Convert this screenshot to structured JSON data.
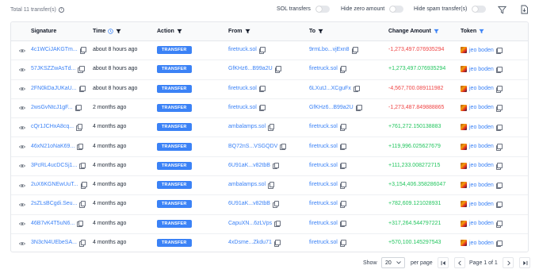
{
  "header": {
    "total_label": "Total 11 transfer(s)",
    "toggles": [
      {
        "label": "SOL transfers",
        "on": false
      },
      {
        "label": "Hide zero amount",
        "on": false
      },
      {
        "label": "Hide spam transfer(s)",
        "on": false
      }
    ],
    "icons": {
      "filter": "filter-icon",
      "export": "export-icon"
    }
  },
  "table": {
    "columns": [
      "Signature",
      "Time",
      "Action",
      "From",
      "To",
      "Change Amount",
      "Token"
    ],
    "rows": [
      {
        "signature": "4c1WCiJAKGTm...",
        "time": "about 8 hours ago",
        "action": "TRANSFER",
        "from": "firetruck.sol",
        "to": "9rmLbo...vjExn8",
        "change": "-1,273,497.076935294",
        "token": "jeo boden"
      },
      {
        "signature": "57JKSZZwAsTd...",
        "time": "about 8 hours ago",
        "action": "TRANSFER",
        "from": "GfKHz6...B99a2U",
        "to": "firetruck.sol",
        "change": "+1,273,497.076935294",
        "token": "jeo boden"
      },
      {
        "signature": "2FN0kDaJUKaU...",
        "time": "about 8 hours ago",
        "action": "TRANSFER",
        "from": "firetruck.sol",
        "to": "6LXutJ...XCguFx",
        "change": "-4,567,700.089111982",
        "token": "jeo boden"
      },
      {
        "signature": "2wsGvNtcJ1gF...",
        "time": "2 months ago",
        "action": "TRANSFER",
        "from": "firetruck.sol",
        "to": "GfKHz6...B99a2U",
        "change": "-1,273,487.849888865",
        "token": "jeo boden"
      },
      {
        "signature": "cQr1JCHxA8cq...",
        "time": "4 months ago",
        "action": "TRANSFER",
        "from": "ambalamps.sol",
        "to": "firetruck.sol",
        "change": "+761,272.150138883",
        "token": "jeo boden"
      },
      {
        "signature": "46xN21oNaK69...",
        "time": "4 months ago",
        "action": "TRANSFER",
        "from": "BQ72nS...VSGQDV",
        "to": "firetruck.sol",
        "change": "+119,996.025627679",
        "token": "jeo boden"
      },
      {
        "signature": "3PcRL4ucDCSj1...",
        "time": "4 months ago",
        "action": "TRANSFER",
        "from": "6U91aK...v82tbB",
        "to": "firetruck.sol",
        "change": "+111,233.008272715",
        "token": "jeo boden"
      },
      {
        "signature": "2uX6KGNEwUuT...",
        "time": "4 months ago",
        "action": "TRANSFER",
        "from": "ambalamps.sol",
        "to": "firetruck.sol",
        "change": "+3,154,406.358286047",
        "token": "jeo boden"
      },
      {
        "signature": "2sZLsBCgdi.Seu...",
        "time": "4 months ago",
        "action": "TRANSFER",
        "from": "6U91aK...v82tbB",
        "to": "firetruck.sol",
        "change": "+782,609.121028931",
        "token": "jeo boden"
      },
      {
        "signature": "46B7vK4T5uN6...",
        "time": "4 months ago",
        "action": "TRANSFER",
        "from": "CapuXN...6zLVps",
        "to": "firetruck.sol",
        "change": "+317,264.544797221",
        "token": "jeo boden"
      },
      {
        "signature": "3N3cN4UEbeSA...",
        "time": "4 months ago",
        "action": "TRANSFER",
        "from": "4xDsme...Zkdu71",
        "to": "firetruck.sol",
        "change": "+570,100.145297543",
        "token": "jeo boden"
      }
    ]
  },
  "pagination": {
    "show_label": "Show",
    "page_size": "20",
    "per_page_label": "per page",
    "page_label": "Page 1 of 1"
  },
  "colors": {
    "accent": "#3b82f6",
    "negative": "#ef4444",
    "positive": "#22c55e"
  }
}
